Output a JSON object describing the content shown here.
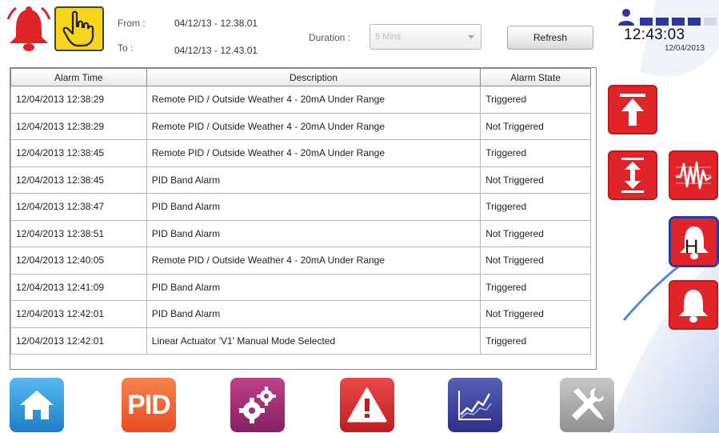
{
  "header": {
    "from_label": "From :",
    "from_value": "04/12/13 - 12.38.01",
    "to_label": "To :",
    "to_value": "04/12/13 - 12.43.01",
    "duration_label": "Duration :",
    "duration_value": "5 Mins",
    "refresh_label": "Refresh"
  },
  "status": {
    "time": "12:43:03",
    "date": "12/04/2013",
    "battery_bars": 4
  },
  "table": {
    "columns": [
      "Alarm Time",
      "Description",
      "Alarm State"
    ],
    "rows": [
      {
        "time": "12/04/2013 12:38:29",
        "description": "Remote PID / Outside Weather 4 - 20mA Under Range",
        "state": "Triggered"
      },
      {
        "time": "12/04/2013 12:38:29",
        "description": "Remote PID / Outside Weather 4 - 20mA Under Range",
        "state": "Not Triggered"
      },
      {
        "time": "12/04/2013 12:38:45",
        "description": "Remote PID / Outside Weather 4 - 20mA Under Range",
        "state": "Triggered"
      },
      {
        "time": "12/04/2013 12:38:45",
        "description": "PID Band Alarm",
        "state": "Not Triggered"
      },
      {
        "time": "12/04/2013 12:38:47",
        "description": "PID Band Alarm",
        "state": "Triggered"
      },
      {
        "time": "12/04/2013 12:38:51",
        "description": "PID Band Alarm",
        "state": "Not Triggered"
      },
      {
        "time": "12/04/2013 12:40:05",
        "description": "Remote PID / Outside Weather 4 - 20mA Under Range",
        "state": "Not Triggered"
      },
      {
        "time": "12/04/2013 12:41:09",
        "description": "PID Band Alarm",
        "state": "Triggered"
      },
      {
        "time": "12/04/2013 12:42:01",
        "description": "PID Band Alarm",
        "state": "Not Triggered"
      },
      {
        "time": "12/04/2013 12:42:01",
        "description": "Linear Actuator 'V1' Manual Mode Selected",
        "state": "Triggered"
      }
    ]
  },
  "side_buttons": {
    "hold_label": "H"
  },
  "nav": {
    "pid_label": "PID",
    "icons": [
      "home-icon",
      "pid-icon",
      "settings-gears-icon",
      "alarm-warning-icon",
      "trend-chart-icon",
      "tools-icon"
    ]
  },
  "colors": {
    "accent_red": "#e0252a",
    "hand_yellow": "#f6d61a",
    "status_blue": "#2b3a9a"
  }
}
